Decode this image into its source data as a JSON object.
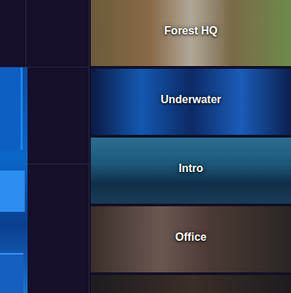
{
  "scenes": [
    {
      "name": "Forest HQ"
    },
    {
      "name": "Underwater"
    },
    {
      "name": "Intro"
    },
    {
      "name": "Office"
    },
    {
      "name": ""
    }
  ]
}
